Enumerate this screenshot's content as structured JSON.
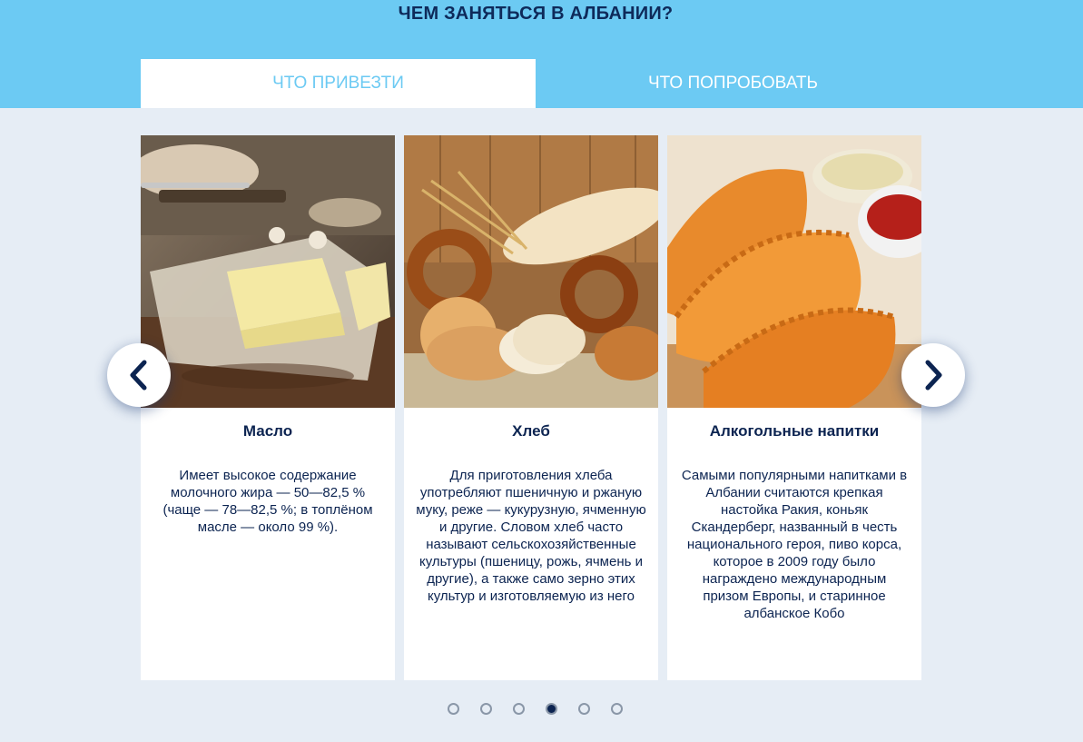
{
  "header": {
    "title": "ЧЕМ ЗАНЯТЬСЯ В АЛБАНИИ?"
  },
  "tabs": [
    {
      "label": "ЧТО ПРИВЕЗТИ",
      "active": true
    },
    {
      "label": "ЧТО ПОПРОБОВАТЬ",
      "active": false
    }
  ],
  "cards": [
    {
      "title": "Масло",
      "text": "Имеет высокое содержание молочного жира — 50—82,5 % (чаще — 78—82,5 %; в топлёном масле — около 99 %).",
      "image": "butter-photo"
    },
    {
      "title": "Хлеб",
      "text": "Для приготовления хлеба употребляют пшеничную и ржаную муку, реже — кукурузную, ячменную и другие. Словом хлеб часто называют сельскохозяйственные культуры (пшеницу, рожь, ячмень и другие), а также само зерно этих культур и изготовляемую из него",
      "image": "bread-photo"
    },
    {
      "title": "Алкогольные напитки",
      "text": "Самыми популярными напитками в Албании считаются крепкая настойка Ракия, коньяк Скандерберг, названный в честь национального героя, пиво корса, которое в 2009 году было награждено международным призом Европы, и старинное албанское Кобо",
      "image": "pastry-photo"
    }
  ],
  "carousel": {
    "prev_icon": "chevron-left-icon",
    "next_icon": "chevron-right-icon",
    "page_count": 6,
    "active_page": 4
  },
  "colors": {
    "header_blue": "#6ccaf3",
    "navy": "#0c2451",
    "page_bg": "#e6edf5"
  }
}
